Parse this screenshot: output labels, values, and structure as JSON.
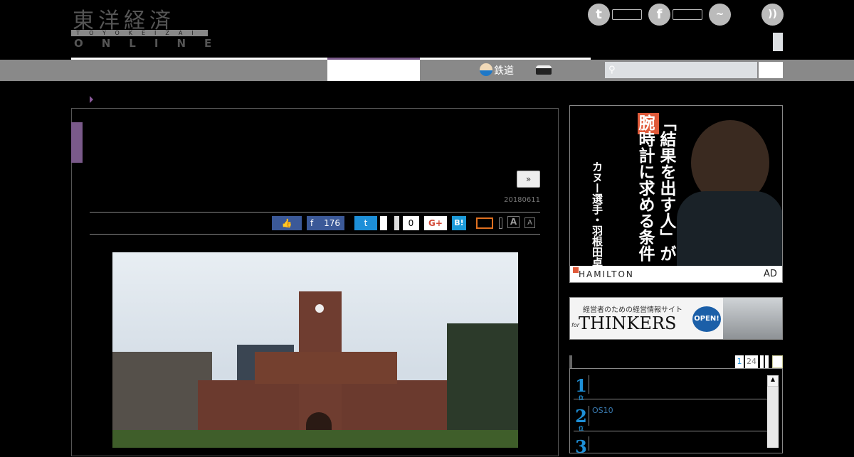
{
  "header": {
    "logo_kanji": "東洋経済",
    "logo_sub": "TOYOKEIZAI",
    "logo_online": "ONLINE"
  },
  "social": {
    "twitter_icon": "twitter-icon",
    "facebook_icon": "facebook-icon",
    "messenger_icon": "messenger-icon",
    "rss_icon": "rss-icon"
  },
  "nav": {
    "railway_label": "鉄道",
    "search_placeholder": ""
  },
  "article": {
    "next_button": "»",
    "date": "20180611",
    "share": {
      "facebook_count": "176",
      "comment_count": "0",
      "gplus": "G+",
      "hatena": "B!",
      "font_large": "A",
      "font_small": "A"
    }
  },
  "ads": {
    "hamilton": {
      "headline": "「結果を出す人」が腕時計に求める条件",
      "sub": "カヌー選手・羽根田卓也",
      "brand": "HAMILTON",
      "label": "AD"
    },
    "thinkers": {
      "tagline": "経営者のための経営情報サイト",
      "name": "THINKERS",
      "prefix": "for",
      "badge": "OPEN!"
    }
  },
  "ranking": {
    "tabs": [
      "1",
      "24"
    ],
    "items": [
      {
        "rank": "1",
        "text": ""
      },
      {
        "rank": "2",
        "text": "OS10"
      },
      {
        "rank": "3",
        "text": ""
      }
    ],
    "rank_suffix": "位"
  }
}
